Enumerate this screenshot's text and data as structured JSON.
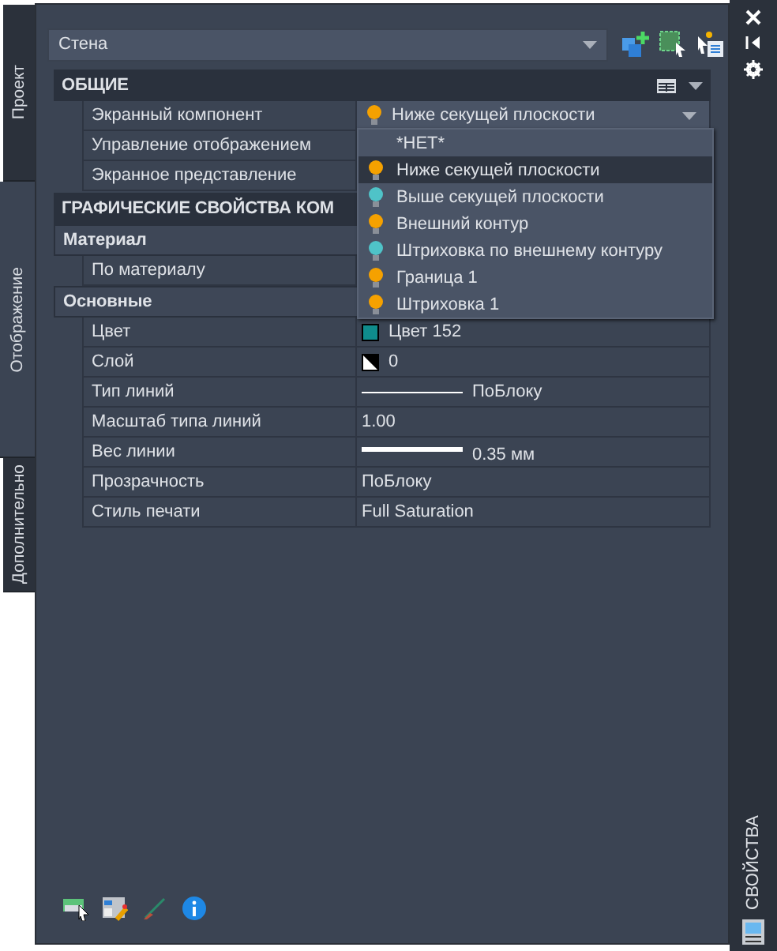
{
  "tabs": [
    {
      "label": "Проект",
      "selected": false
    },
    {
      "label": "Отображение",
      "selected": true
    },
    {
      "label": "Дополнительно",
      "selected": false
    }
  ],
  "object_select": {
    "value": "Стена"
  },
  "sections": [
    {
      "title": "ОБЩИЕ",
      "kind": "main",
      "rows": [
        {
          "label": "Экранный компонент",
          "kind": "dropdown",
          "value": "Ниже секущей плоскости",
          "color": "#f5a100"
        },
        {
          "label": "Управление отображением",
          "kind": "text"
        },
        {
          "label": "Экранное представление",
          "kind": "text"
        }
      ]
    },
    {
      "title": "ГРАФИЧЕСКИЕ СВОЙСТВА КОМ",
      "kind": "main"
    },
    {
      "title": "Материал",
      "kind": "sub",
      "rows": [
        {
          "label": "По материалу",
          "kind": "text"
        }
      ]
    },
    {
      "title": "Основные",
      "kind": "sub",
      "rows": [
        {
          "label": "Цвет",
          "kind": "swatch",
          "value": "Цвет 152",
          "color": "#0f8c8c"
        },
        {
          "label": "Слой",
          "kind": "layer",
          "value": "0"
        },
        {
          "label": "Тип линий",
          "kind": "linetype",
          "value": "ПоБлоку"
        },
        {
          "label": "Масштаб типа линий",
          "kind": "text",
          "value": "1.00"
        },
        {
          "label": "Вес линии",
          "kind": "lineweight",
          "value": "0.35 мм"
        },
        {
          "label": "Прозрачность",
          "kind": "text",
          "value": "ПоБлоку"
        },
        {
          "label": "Стиль печати",
          "kind": "text",
          "value": "Full Saturation"
        }
      ]
    }
  ],
  "popup": {
    "items": [
      {
        "label": "*НЕТ*",
        "selected": false
      },
      {
        "label": "Ниже секущей плоскости",
        "selected": true,
        "color": "#f5a100"
      },
      {
        "label": "Выше секущей плоскости",
        "selected": false,
        "color": "#4fc3c8"
      },
      {
        "label": "Внешний контур",
        "selected": false,
        "color": "#f5a100"
      },
      {
        "label": "Штриховка по внешнему контуру",
        "selected": false,
        "color": "#4fc3c8"
      },
      {
        "label": "Граница 1",
        "selected": false,
        "color": "#f5a100"
      },
      {
        "label": "Штриховка 1",
        "selected": false,
        "color": "#f5a100"
      }
    ]
  },
  "palette_title": "СВОЙСТВА"
}
